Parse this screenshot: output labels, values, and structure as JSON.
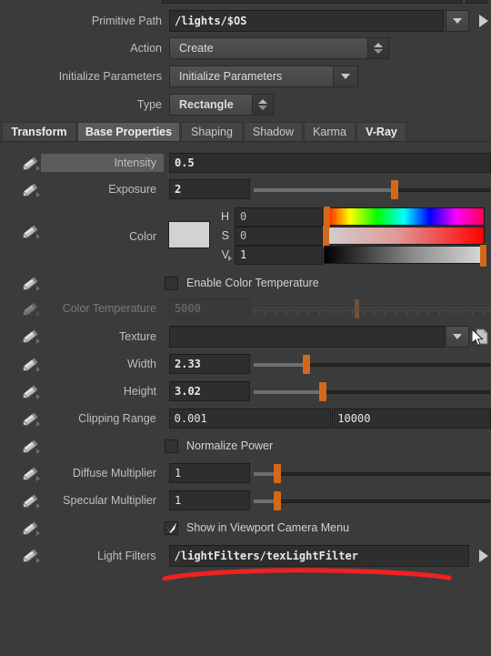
{
  "header": {
    "rows": [
      {
        "label": "Primitive Path",
        "value": "/lights/$OS",
        "kind": "path"
      },
      {
        "label": "Action",
        "value": "Create",
        "kind": "stepper-menu"
      },
      {
        "label": "Initialize Parameters",
        "value": "Initialize Parameters",
        "kind": "menu"
      },
      {
        "label": "Type",
        "value": "Rectangle",
        "kind": "stepper-menu-small"
      }
    ]
  },
  "tabs": [
    {
      "label": "Transform",
      "active": false,
      "bold": true
    },
    {
      "label": "Base Properties",
      "active": true,
      "bold": true
    },
    {
      "label": "Shaping",
      "active": false,
      "bold": false
    },
    {
      "label": "Shadow",
      "active": false,
      "bold": false
    },
    {
      "label": "Karma",
      "active": false,
      "bold": false
    },
    {
      "label": "V-Ray",
      "active": false,
      "bold": true
    }
  ],
  "params": {
    "intensity": {
      "label": "Intensity",
      "value": "0.5"
    },
    "exposure": {
      "label": "Exposure",
      "value": "2"
    },
    "color": {
      "label": "Color",
      "swatch_hex": "#d2d2d2",
      "channels": [
        {
          "label": "H",
          "value": "0"
        },
        {
          "label": "S",
          "value": "0"
        },
        {
          "label": "V",
          "value": "1"
        }
      ]
    },
    "enable_color_temperature": {
      "label": "Enable Color Temperature",
      "checked": false
    },
    "color_temperature": {
      "label": "Color Temperature",
      "value": "5000",
      "disabled": true
    },
    "texture": {
      "label": "Texture",
      "value": ""
    },
    "width": {
      "label": "Width",
      "value": "2.33"
    },
    "height": {
      "label": "Height",
      "value": "3.02"
    },
    "clipping_range": {
      "label": "Clipping Range",
      "value_min": "0.001",
      "value_max": "10000"
    },
    "normalize_power": {
      "label": "Normalize Power",
      "checked": false
    },
    "diffuse_multiplier": {
      "label": "Diffuse Multiplier",
      "value": "1"
    },
    "specular_multiplier": {
      "label": "Specular Multiplier",
      "value": "1"
    },
    "show_in_viewport_camera_menu": {
      "label": "Show in Viewport Camera Menu",
      "checked": true
    },
    "light_filters": {
      "label": "Light Filters",
      "value": "/lightFilters/texLightFilter"
    }
  },
  "icons": {
    "pencil": "pencil-icon",
    "chevron_down": "chevron-down-icon",
    "jump_arrow": "jump-to-node-icon",
    "file_browse": "file-browse-icon",
    "cursor": "mouse-cursor"
  },
  "annotation": {
    "shape": "red-underline",
    "color": "#ee2222"
  },
  "colors": {
    "panel_bg": "#3b3b3b",
    "field_bg": "#2e2e2e",
    "slider_handle": "#d4681a",
    "tab_active": "#5a5a5a",
    "accent_orange": "#d4681a"
  }
}
